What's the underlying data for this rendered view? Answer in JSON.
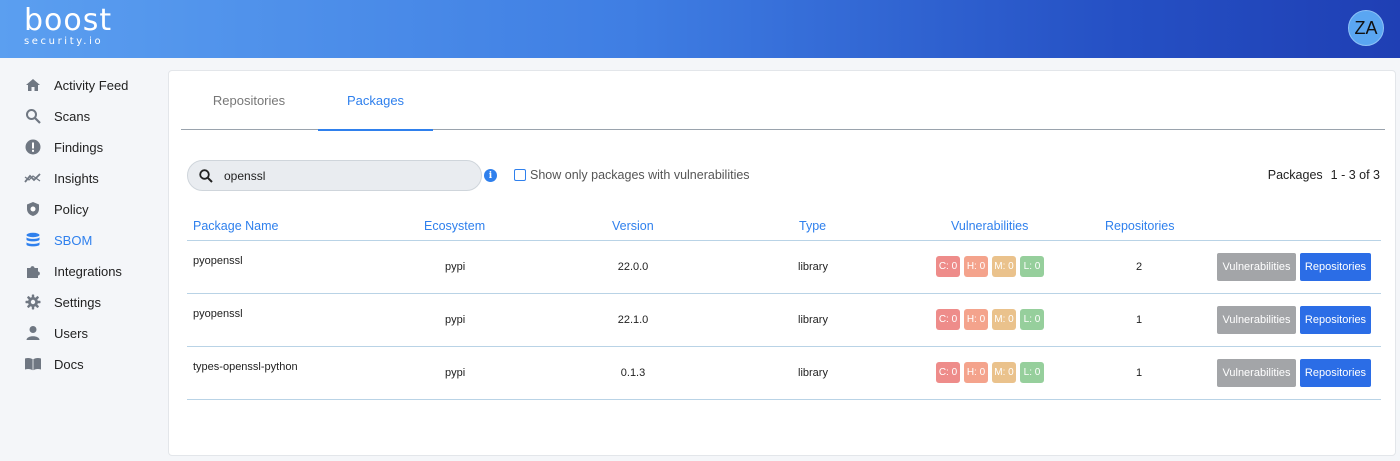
{
  "header": {
    "logo_main": "boost",
    "logo_sub": "security.io",
    "avatar_initials": "ZA"
  },
  "sidebar": {
    "items": [
      {
        "label": "Activity Feed",
        "icon": "home-icon"
      },
      {
        "label": "Scans",
        "icon": "search-icon"
      },
      {
        "label": "Findings",
        "icon": "alert-icon"
      },
      {
        "label": "Insights",
        "icon": "trend-icon"
      },
      {
        "label": "Policy",
        "icon": "shield-icon"
      },
      {
        "label": "SBOM",
        "icon": "database-icon",
        "active": true
      },
      {
        "label": "Integrations",
        "icon": "puzzle-icon"
      },
      {
        "label": "Settings",
        "icon": "gear-icon"
      },
      {
        "label": "Users",
        "icon": "user-icon"
      },
      {
        "label": "Docs",
        "icon": "book-icon"
      }
    ]
  },
  "tabs": {
    "repositories": "Repositories",
    "packages": "Packages"
  },
  "search": {
    "value": "openssl"
  },
  "filter": {
    "label": "Show only packages with vulnerabilities",
    "checked": false
  },
  "pager": {
    "label": "Packages",
    "range": "1 - 3 of 3"
  },
  "table": {
    "headers": {
      "name": "Package Name",
      "ecosystem": "Ecosystem",
      "version": "Version",
      "type": "Type",
      "vulnerabilities": "Vulnerabilities",
      "repositories": "Repositories"
    },
    "rows": [
      {
        "name": "pyopenssl",
        "ecosystem": "pypi",
        "version": "22.0.0",
        "type": "library",
        "c": "C: 0",
        "h": "H: 0",
        "m": "M: 0",
        "l": "L: 0",
        "repositories": "2"
      },
      {
        "name": "pyopenssl",
        "ecosystem": "pypi",
        "version": "22.1.0",
        "type": "library",
        "c": "C: 0",
        "h": "H: 0",
        "m": "M: 0",
        "l": "L: 0",
        "repositories": "1"
      },
      {
        "name": "types-openssl-python",
        "ecosystem": "pypi",
        "version": "0.1.3",
        "type": "library",
        "c": "C: 0",
        "h": "H: 0",
        "m": "M: 0",
        "l": "L: 0",
        "repositories": "1"
      }
    ],
    "button_vulnerabilities": "Vulnerabilities",
    "button_repositories": "Repositories"
  },
  "colors": {
    "accent": "#2f80ed",
    "critical": "#ee8c8a",
    "high": "#f4a38c",
    "medium": "#eac28c",
    "low": "#96cf9c",
    "button_grey": "#a3a5a8",
    "button_blue": "#2b6de6"
  }
}
